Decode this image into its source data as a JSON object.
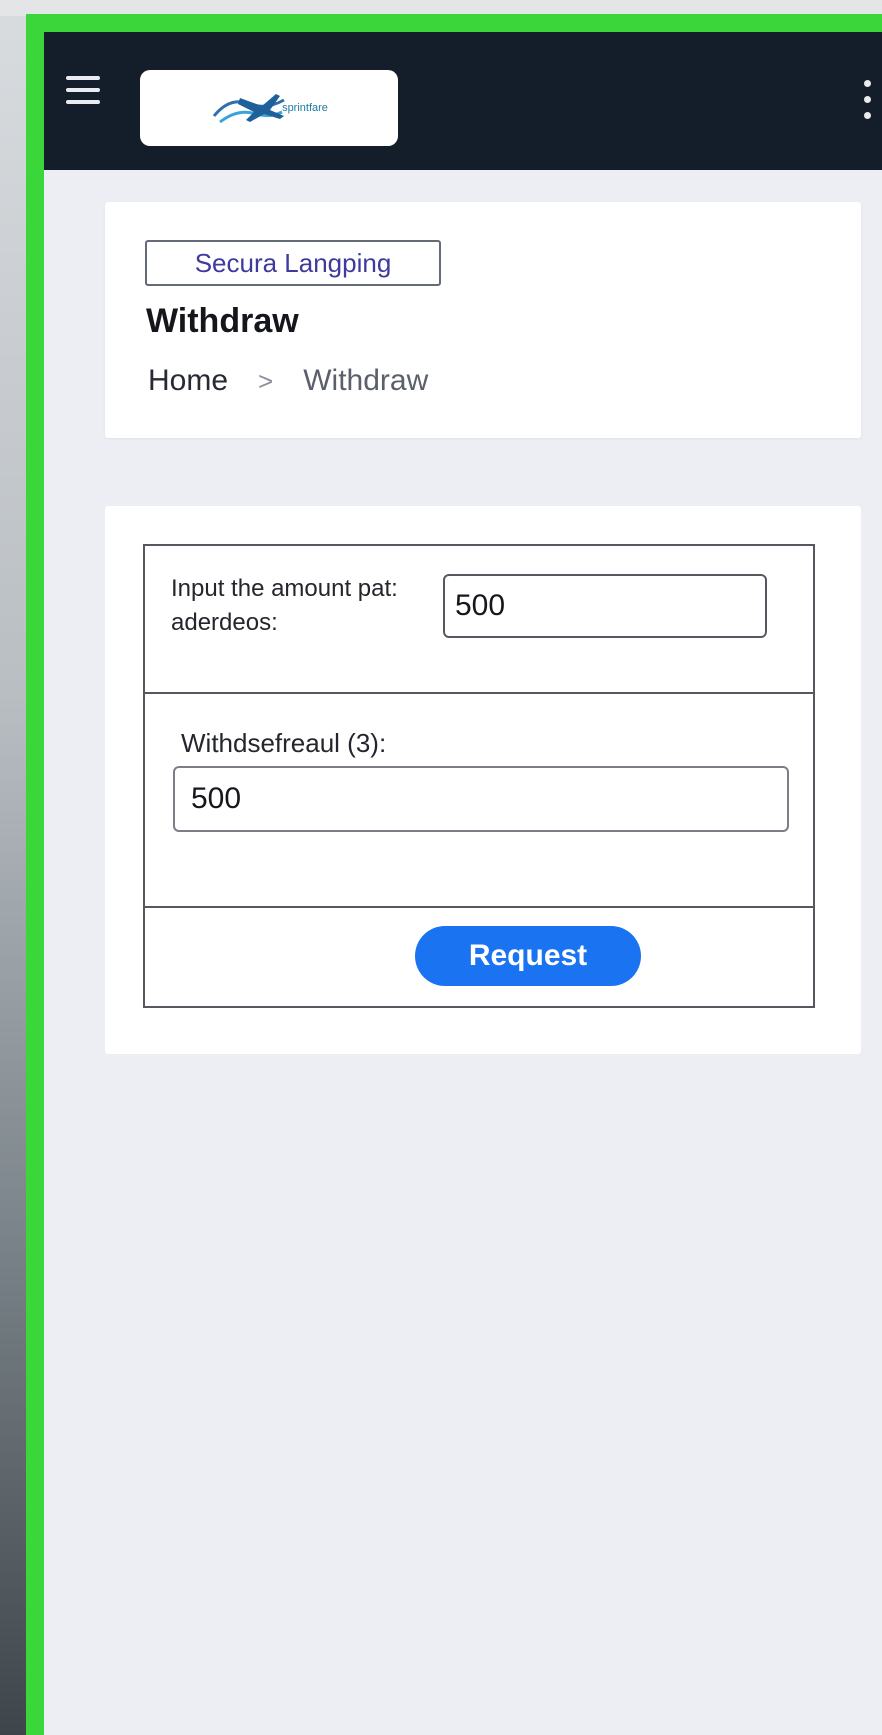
{
  "header": {
    "menu_icon": "hamburger-icon",
    "logo_text": "sprintfare",
    "more_icon": "kebab-icon"
  },
  "page": {
    "tag": "Secura Langping",
    "title": "Withdraw",
    "breadcrumb": {
      "home": "Home",
      "separator": ">",
      "current": "Withdraw"
    }
  },
  "form": {
    "amount_label": "Input the amount pat: aderdeos:",
    "amount_value": "500",
    "withdrawal_label": "Withdsefreaul (3):",
    "withdrawal_value": "500",
    "submit_label": "Request"
  },
  "colors": {
    "accent": "#1a73f0",
    "topbar": "#141e2b",
    "frame_border": "#3ad63a"
  }
}
